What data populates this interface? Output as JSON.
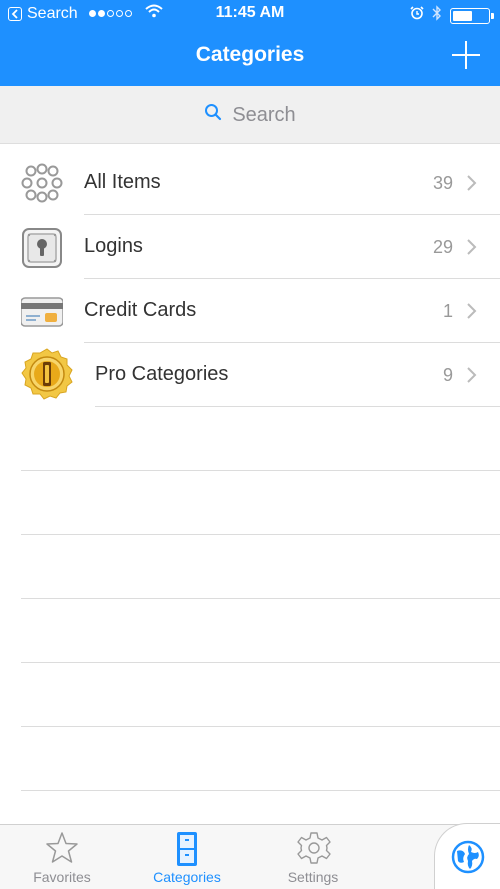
{
  "status_bar": {
    "back_app": "Search",
    "time": "11:45 AM",
    "battery_level": 0.55
  },
  "nav": {
    "title": "Categories",
    "add_icon": "plus-icon"
  },
  "search": {
    "placeholder": "Search"
  },
  "categories": [
    {
      "label": "All Items",
      "count": "39",
      "icon": "all-items-icon"
    },
    {
      "label": "Logins",
      "count": "29",
      "icon": "login-icon"
    },
    {
      "label": "Credit Cards",
      "count": "1",
      "icon": "credit-card-icon"
    },
    {
      "label": "Pro Categories",
      "count": "9",
      "icon": "pro-badge-icon"
    }
  ],
  "tabs": [
    {
      "label": "Favorites",
      "icon": "star-icon"
    },
    {
      "label": "Categories",
      "icon": "cabinet-icon",
      "active": true
    },
    {
      "label": "Settings",
      "icon": "gear-icon"
    }
  ],
  "colors": {
    "accent": "#1e90ff",
    "row_text": "#333333",
    "count_text": "#999999"
  }
}
